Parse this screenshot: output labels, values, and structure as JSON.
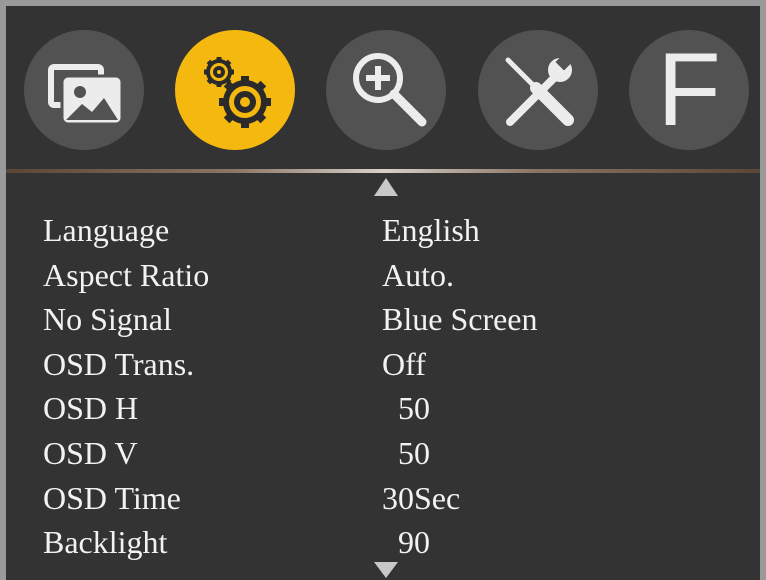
{
  "tabs": [
    {
      "name": "picture",
      "icon": "picture-icon",
      "active": false
    },
    {
      "name": "setup",
      "icon": "gears-icon",
      "active": true
    },
    {
      "name": "zoom",
      "icon": "zoom-in-icon",
      "active": false
    },
    {
      "name": "tools",
      "icon": "screwdriver-wrench-icon",
      "active": false
    },
    {
      "name": "function",
      "icon": "letter-f-icon",
      "letter": "F",
      "active": false
    }
  ],
  "colors": {
    "panel_background": "#333333",
    "tab_background": "#525252",
    "active_tab": "#f5b80f",
    "frame": "#9a9a9a",
    "text": "#f2f2f2"
  },
  "menu": {
    "scroll_up_icon": "triangle-up-icon",
    "scroll_down_icon": "triangle-down-icon",
    "items": [
      {
        "label": "Language",
        "value": "English"
      },
      {
        "label": "Aspect Ratio",
        "value": "Auto."
      },
      {
        "label": "No Signal",
        "value": "Blue Screen"
      },
      {
        "label": "OSD Trans.",
        "value": "Off"
      },
      {
        "label": "OSD H",
        "value": "  50"
      },
      {
        "label": "OSD V",
        "value": "  50"
      },
      {
        "label": "OSD Time",
        "value": "30Sec"
      },
      {
        "label": "Backlight",
        "value": "  90"
      }
    ]
  }
}
